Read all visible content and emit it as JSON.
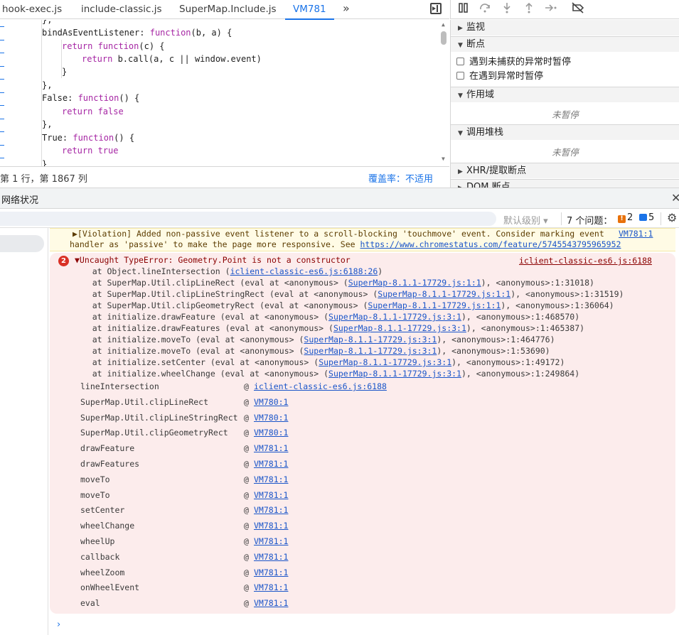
{
  "tabs": [
    {
      "label": "hook-exec.js"
    },
    {
      "label": "include-classic.js"
    },
    {
      "label": "SuperMap.Include.js"
    },
    {
      "label": "VM781"
    }
  ],
  "tab_more": "»",
  "code": {
    "lines": [
      {
        "text": "},"
      },
      {
        "parts": [
          [
            "plain",
            "bindAsEventListener"
          ],
          [
            "plain",
            ": "
          ],
          [
            "kw",
            "function"
          ],
          [
            "plain",
            "(b, a) {"
          ]
        ]
      },
      {
        "parts": [
          [
            "kw",
            "return "
          ],
          [
            "kw",
            "function"
          ],
          [
            "plain",
            "(c) {"
          ]
        ]
      },
      {
        "parts": [
          [
            "kw",
            "return "
          ],
          [
            "plain",
            "b.call(a, c || window.event)"
          ]
        ]
      },
      {
        "text": "}"
      },
      {
        "text": "},"
      },
      {
        "parts": [
          [
            "plain",
            "False: "
          ],
          [
            "kw",
            "function"
          ],
          [
            "plain",
            "() {"
          ]
        ]
      },
      {
        "parts": [
          [
            "kw",
            "return "
          ],
          [
            "plain",
            "false"
          ]
        ]
      },
      {
        "text": "},"
      },
      {
        "parts": [
          [
            "plain",
            "True: "
          ],
          [
            "kw",
            "function"
          ],
          [
            "plain",
            "() {"
          ]
        ]
      },
      {
        "parts": [
          [
            "kw",
            "return "
          ],
          [
            "plain",
            "true"
          ]
        ]
      },
      {
        "text": "}"
      }
    ]
  },
  "status": {
    "cursor": "第 1 行，第 1867 列",
    "coverage": "覆盖率：不适用"
  },
  "sidebar": {
    "watch": "监视",
    "breakpoints": "断点",
    "pause_uncaught": "遇到未捕获的异常时暂停",
    "pause_caught": "在遇到异常时暂停",
    "scope": "作用域",
    "not_paused": "未暂停",
    "call_stack": "调用堆栈",
    "not_paused_2": "未暂停",
    "xhr": "XHR/提取断点",
    "dom": "DOM 断点"
  },
  "drawer": {
    "title": "网络状况",
    "close": "✕"
  },
  "console_toolbar": {
    "level": "默认级别 ▾",
    "issues_label": "7 个问题：",
    "warn_count": "2",
    "info_count": "5"
  },
  "violation": {
    "line1": "▶[Violation] Added non-passive event listener to a scroll-blocking 'touchmove' event. Consider marking event",
    "line1_link": "VM781:1",
    "line2": "handler as 'passive' to make the page more responsive. See ",
    "line2_link": "https://www.chromestatus.com/feature/5745543795965952"
  },
  "error": {
    "badge": "2",
    "message": "▼Uncaught TypeError: Geometry.Point is not a constructor",
    "source": "iclient-classic-es6.js:6188",
    "trace": [
      {
        "pre": "    at Object.lineIntersection (",
        "link": "iclient-classic-es6.js:6188:26",
        "post": ")"
      },
      {
        "pre": "    at SuperMap.Util.clipLineRect (eval at <anonymous> (",
        "link": "SuperMap-8.1.1-17729.js:1:1",
        "post": "), <anonymous>:1:31018)"
      },
      {
        "pre": "    at SuperMap.Util.clipLineStringRect (eval at <anonymous> (",
        "link": "SuperMap-8.1.1-17729.js:1:1",
        "post": "), <anonymous>:1:31519)"
      },
      {
        "pre": "    at SuperMap.Util.clipGeometryRect (eval at <anonymous> (",
        "link": "SuperMap-8.1.1-17729.js:1:1",
        "post": "), <anonymous>:1:36064)"
      },
      {
        "pre": "    at initialize.drawFeature (eval at <anonymous> (",
        "link": "SuperMap-8.1.1-17729.js:3:1",
        "post": "), <anonymous>:1:468570)"
      },
      {
        "pre": "    at initialize.drawFeatures (eval at <anonymous> (",
        "link": "SuperMap-8.1.1-17729.js:3:1",
        "post": "), <anonymous>:1:465387)"
      },
      {
        "pre": "    at initialize.moveTo (eval at <anonymous> (",
        "link": "SuperMap-8.1.1-17729.js:3:1",
        "post": "), <anonymous>:1:464776)"
      },
      {
        "pre": "    at initialize.moveTo (eval at <anonymous> (",
        "link": "SuperMap-8.1.1-17729.js:3:1",
        "post": "), <anonymous>:1:53690)"
      },
      {
        "pre": "    at initialize.setCenter (eval at <anonymous> (",
        "link": "SuperMap-8.1.1-17729.js:3:1",
        "post": "), <anonymous>:1:49172)"
      },
      {
        "pre": "    at initialize.wheelChange (eval at <anonymous> (",
        "link": "SuperMap-8.1.1-17729.js:3:1",
        "post": "), <anonymous>:1:249864)"
      }
    ],
    "stack": [
      {
        "fn": "lineIntersection",
        "at": "@",
        "src": "iclient-classic-es6.js:6188"
      },
      {
        "fn": "SuperMap.Util.clipLineRect",
        "at": "@",
        "src": "VM780:1"
      },
      {
        "fn": "SuperMap.Util.clipLineStringRect",
        "at": "@",
        "src": "VM780:1"
      },
      {
        "fn": "SuperMap.Util.clipGeometryRect",
        "at": "@",
        "src": "VM780:1"
      },
      {
        "fn": "drawFeature",
        "at": "@",
        "src": "VM781:1"
      },
      {
        "fn": "drawFeatures",
        "at": "@",
        "src": "VM781:1"
      },
      {
        "fn": "moveTo",
        "at": "@",
        "src": "VM781:1"
      },
      {
        "fn": "moveTo",
        "at": "@",
        "src": "VM781:1"
      },
      {
        "fn": "setCenter",
        "at": "@",
        "src": "VM781:1"
      },
      {
        "fn": "wheelChange",
        "at": "@",
        "src": "VM781:1"
      },
      {
        "fn": "wheelUp",
        "at": "@",
        "src": "VM781:1"
      },
      {
        "fn": "callback",
        "at": "@",
        "src": "VM781:1"
      },
      {
        "fn": "wheelZoom",
        "at": "@",
        "src": "VM781:1"
      },
      {
        "fn": "onWheelEvent",
        "at": "@",
        "src": "VM781:1"
      },
      {
        "fn": "eval",
        "at": "@",
        "src": "VM781:1"
      }
    ]
  },
  "prompt": "›",
  "colors": {
    "accent": "#1a73e8",
    "error_bg": "#fcecec",
    "warning_bg": "#fffbe5",
    "keyword": "#a626a4"
  }
}
